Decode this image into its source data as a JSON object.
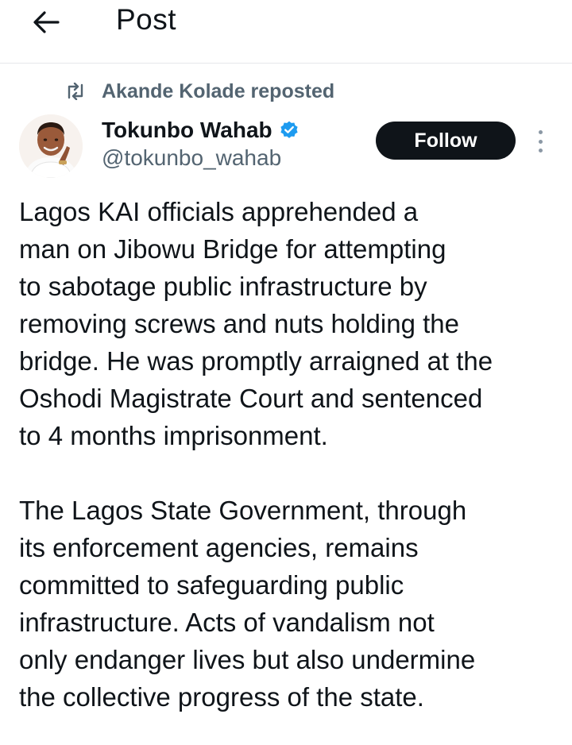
{
  "header": {
    "back_icon": "arrow-left-icon",
    "title": "Post"
  },
  "repost": {
    "icon": "repost-icon",
    "text": "Akande Kolade reposted"
  },
  "author": {
    "display_name": "Tokunbo Wahab",
    "verified_icon": "verified-badge-icon",
    "verified_color": "#1d9bf0",
    "handle": "@tokunbo_wahab"
  },
  "actions": {
    "follow_label": "Follow",
    "more_icon": "more-vertical-icon"
  },
  "tweet": {
    "paragraph_1": [
      "Lagos KAI officials apprehended a",
      "man on Jibowu Bridge for attempting",
      "to sabotage public infrastructure by",
      "removing screws and nuts holding the",
      "bridge. He was promptly arraigned at the",
      "Oshodi Magistrate Court and sentenced",
      "to 4 months imprisonment."
    ],
    "paragraph_2": [
      "The Lagos State Government, through",
      "its enforcement agencies, remains",
      "committed to safeguarding public",
      "infrastructure. Acts of vandalism not",
      "only endanger lives but also undermine",
      "the collective progress of the state."
    ]
  },
  "colors": {
    "text_primary": "#0f1419",
    "text_secondary": "#536471",
    "follow_bg": "#0f1419",
    "follow_text": "#ffffff",
    "divider": "#e6e8ea"
  }
}
